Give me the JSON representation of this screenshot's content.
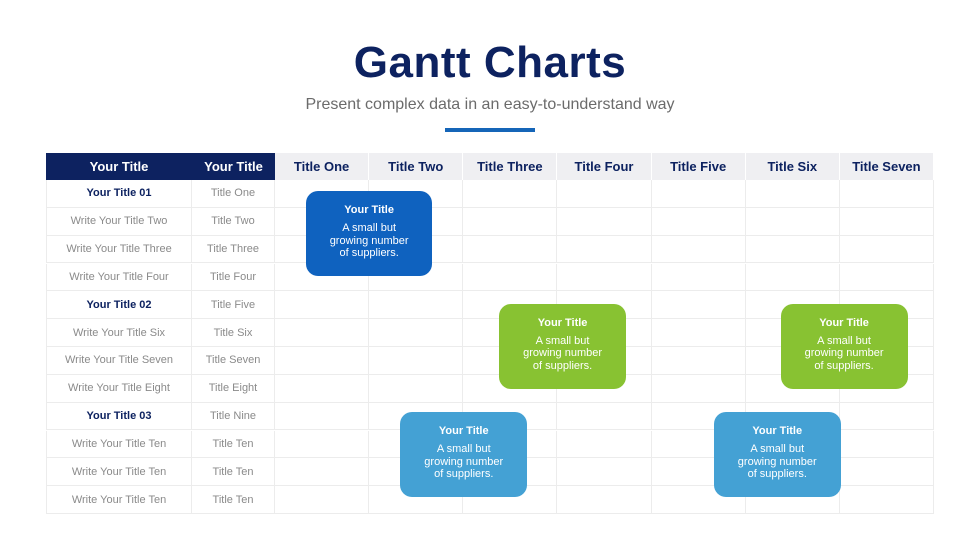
{
  "header": {
    "title": "Gantt Charts",
    "subtitle": "Present complex data in an easy-to-understand way"
  },
  "colors": {
    "navy": "#0d2260",
    "accent_line": "#1565b8",
    "bar_blue": "#0f62bf",
    "bar_green": "#88c232",
    "bar_lightblue": "#44a1d4",
    "header_light": "#efeff2"
  },
  "table": {
    "row_headers": [
      "Your Title",
      "Your Title"
    ],
    "columns": [
      "Title One",
      "Title Two",
      "Title Three",
      "Title Four",
      "Title Five",
      "Title Six",
      "Title Seven"
    ],
    "rows": [
      {
        "name": "Your Title 01",
        "title": "Title One",
        "bold": true
      },
      {
        "name": "Write Your Title Two",
        "title": "Title Two",
        "bold": false
      },
      {
        "name": "Write Your Title Three",
        "title": "Title Three",
        "bold": false
      },
      {
        "name": "Write Your Title Four",
        "title": "Title Four",
        "bold": false
      },
      {
        "name": "Your Title 02",
        "title": "Title Five",
        "bold": true
      },
      {
        "name": "Write Your Title Six",
        "title": "Title Six",
        "bold": false
      },
      {
        "name": "Write Your Title Seven",
        "title": "Title Seven",
        "bold": false
      },
      {
        "name": "Write Your Title Eight",
        "title": "Title Eight",
        "bold": false
      },
      {
        "name": "Your Title 03",
        "title": "Title Nine",
        "bold": true
      },
      {
        "name": "Write Your Title Ten",
        "title": "Title Ten",
        "bold": false
      },
      {
        "name": "Write Your Title Ten",
        "title": "Title Ten",
        "bold": false
      },
      {
        "name": "Write Your Title Ten",
        "title": "Title Ten",
        "bold": false
      }
    ]
  },
  "tasks": [
    {
      "title": "Your Title",
      "desc": "A small but growing number of suppliers.",
      "color": "bar_blue",
      "start_col": 0.33,
      "end_col": 1.67,
      "start_row": 0.4,
      "end_row": 3.45
    },
    {
      "title": "Your Title",
      "desc": "A small but growing number of suppliers.",
      "color": "bar_green",
      "start_col": 2.38,
      "end_col": 3.73,
      "start_row": 4.45,
      "end_row": 7.5
    },
    {
      "title": "Your Title",
      "desc": "A small but growing number of suppliers.",
      "color": "bar_green",
      "start_col": 5.37,
      "end_col": 6.72,
      "start_row": 4.45,
      "end_row": 7.5
    },
    {
      "title": "Your Title",
      "desc": "A small but growing number of suppliers.",
      "color": "bar_lightblue",
      "start_col": 1.33,
      "end_col": 2.68,
      "start_row": 8.35,
      "end_row": 11.4
    },
    {
      "title": "Your Title",
      "desc": "A small but growing number of suppliers.",
      "color": "bar_lightblue",
      "start_col": 4.66,
      "end_col": 6.01,
      "start_row": 8.35,
      "end_row": 11.4
    }
  ]
}
